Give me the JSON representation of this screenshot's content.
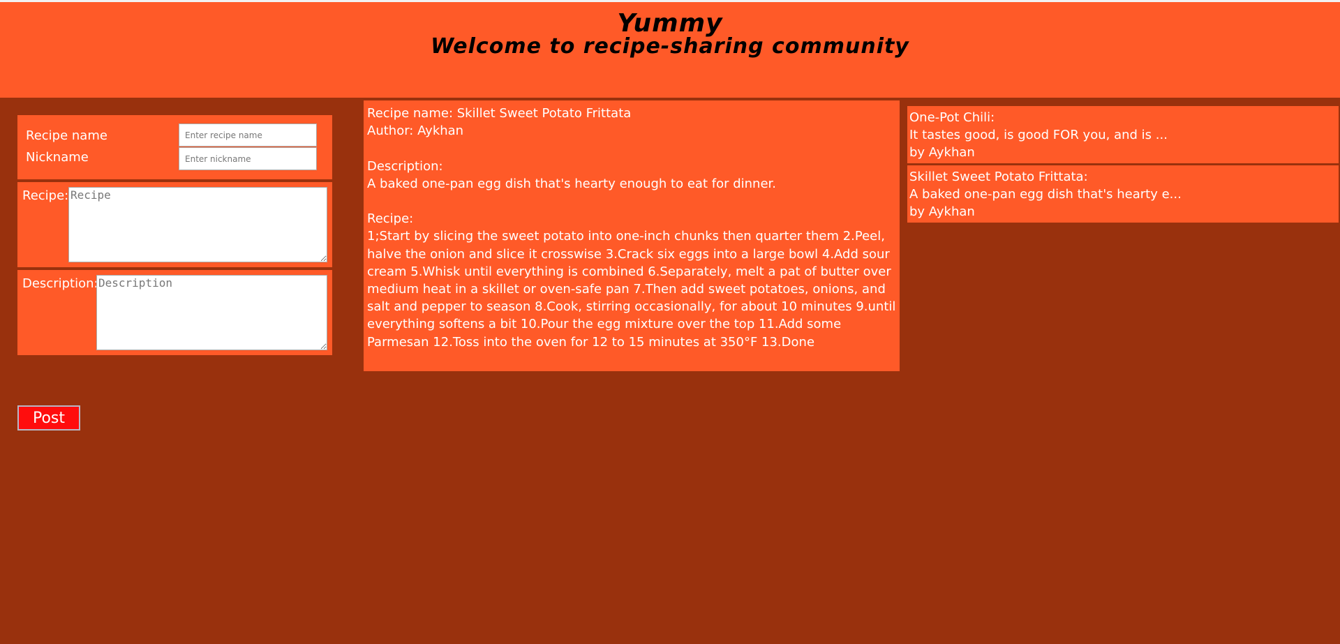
{
  "header": {
    "title": "Yummy",
    "subtitle": "Welcome to recipe-sharing community"
  },
  "form": {
    "recipe_name_label": "Recipe name",
    "recipe_name_placeholder": "Enter recipe name",
    "nickname_label": "Nickname",
    "nickname_placeholder": "Enter nickname",
    "recipe_label": "Recipe:",
    "recipe_placeholder": "Recipe",
    "description_label": "Description:",
    "description_placeholder": "Description",
    "post_button": "Post"
  },
  "detail": {
    "recipe_name_line": "Recipe name: Skillet Sweet Potato Frittata",
    "author_line": "Author: Aykhan",
    "description_heading": "Description:",
    "description_text": "A baked one-pan egg dish that's hearty enough to eat for dinner.",
    "recipe_heading": "Recipe:",
    "recipe_text": "1;Start by slicing the sweet potato into one-inch chunks then quarter them 2.Peel, halve the onion and slice it crosswise 3.Crack six eggs into a large bowl 4.Add sour cream 5.Whisk until everything is combined 6.Separately, melt a pat of butter over medium heat in a skillet or oven-safe pan 7.Then add sweet potatoes, onions, and salt and pepper to season 8.Cook, stirring occasionally, for about 10 minutes 9.until everything softens a bit 10.Pour the egg mixture over the top 11.Add some Parmesan 12.Toss into the oven for 12 to 15 minutes at 350°F 13.Done"
  },
  "recipe_list": [
    {
      "title": "One-Pot Chili:",
      "excerpt": "It tastes good, is good FOR you, and is ...",
      "author": "by Aykhan"
    },
    {
      "title": "Skillet Sweet Potato Frittata:",
      "excerpt": "A baked one-pan egg dish that's hearty e...",
      "author": "by Aykhan"
    }
  ],
  "colors": {
    "background": "#99310d",
    "panel": "#ff5a28",
    "post_button": "#ff0d0d",
    "text": "#ffffff",
    "header_text": "#000000"
  }
}
